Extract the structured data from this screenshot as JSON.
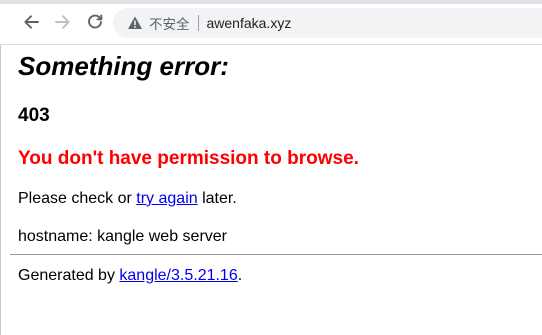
{
  "browser": {
    "security_label": "不安全",
    "url": "awenfaka.xyz"
  },
  "page": {
    "title": "Something error:",
    "code": "403",
    "message": "You don't have permission to browse.",
    "retry": {
      "prefix": "Please check or ",
      "link_text": "try again",
      "suffix": " later."
    },
    "hostname_line": "hostname: kangle web server",
    "footer": {
      "prefix": "Generated by ",
      "link_text": "kangle/3.5.21.16",
      "suffix": "."
    }
  },
  "colors": {
    "error_red": "#ff0000",
    "link_blue": "#0000ee"
  }
}
